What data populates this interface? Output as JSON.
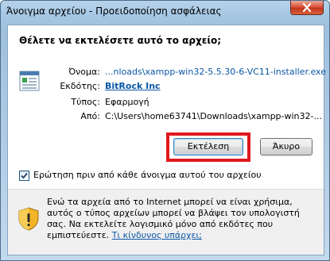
{
  "window": {
    "title": "Άνοιγμα αρχείου - Προειδοποίηση ασφάλειας"
  },
  "heading": "Θέλετε να εκτελέσετε αυτό το αρχείο;",
  "details": {
    "name_label": "Όνομα:",
    "name_value": "...nloads\\xampp-win32-5.5.30-6-VC11-installer.exe",
    "publisher_label": "Εκδότης:",
    "publisher_value": "BitRock Inc",
    "type_label": "Τύπος:",
    "type_value": "Εφαρμογή",
    "from_label": "Από:",
    "from_value": "C:\\Users\\home63741\\Downloads\\xampp-win32-..."
  },
  "buttons": {
    "run_label": "Εκτέλεση",
    "cancel_label": "Άκυρο"
  },
  "checkbox": {
    "label": "Ερώτηση πριν από κάθε άνοιγμα αυτού του αρχείου",
    "checked": true
  },
  "warning": {
    "text": "Ενώ τα αρχεία από το Internet μπορεί να είναι χρήσιμα, αυτός ο τύπος αρχείων μπορεί να βλάψει τον υπολογιστή σας. Να εκτελείτε λογισμικό μόνο από εκδότες που εμπιστεύεστε.",
    "link_label": "Τι κίνδυνος υπάρχει;"
  },
  "colors": {
    "highlight": "#e0191d",
    "link": "#0a57a6"
  }
}
